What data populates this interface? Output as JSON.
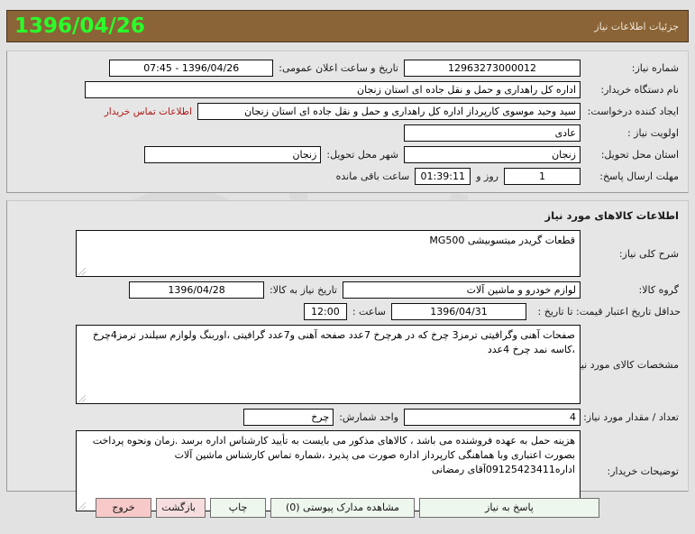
{
  "header": {
    "date": "1396/04/26",
    "title": "جزئیات اطلاعات نیاز"
  },
  "top_panel": {
    "need_number_label": "شماره نیاز:",
    "need_number_value": "12963273000012",
    "announce_label": "تاریخ و ساعت اعلان عمومی:",
    "announce_value": "1396/04/26 - 07:45",
    "buyer_org_label": "نام دستگاه خریدار:",
    "buyer_org_value": "اداره کل راهداری و حمل و نقل جاده ای استان زنجان",
    "creator_label": "ایجاد کننده درخواست:",
    "creator_value": "سید وحید موسوی کارپرداز اداره کل راهداری و حمل و نقل جاده ای استان زنجان",
    "contact_link": "اطلاعات تماس خریدار",
    "priority_label": "اولویت نیاز :",
    "priority_value": "عادی",
    "province_label": "استان محل تحویل:",
    "province_value": "زنجان",
    "city_label": "شهر محل تحویل:",
    "city_value": "زنجان",
    "deadline_label": "مهلت ارسال پاسخ:",
    "deadline_days": "1",
    "deadline_days_suffix": "روز و",
    "deadline_clock": "01:39:11",
    "deadline_suffix": "ساعت باقی مانده"
  },
  "goods_panel": {
    "title": "اطلاعات کالاهای مورد نیاز",
    "desc_label": "شرح کلی نیاز:",
    "desc_value": "قطعات گریدر میتسوبیشی MG500",
    "group_label": "گروه کالا:",
    "group_value": "لوازم خودرو و ماشین آلات",
    "need_date_label": "تاریخ نیاز به کالا:",
    "need_date_value": "1396/04/28",
    "valid_label": "حداقل تاریخ اعتبار قیمت:  تا تاریخ :",
    "valid_date_value": "1396/04/31",
    "time_label": "ساعت :",
    "time_value": "12:00",
    "specs_label": "مشخصات کالای مورد نیاز:",
    "specs_value": "صفحات آهنی وگرافیتی ترمز3 چرخ که در هرچرخ 7عدد صفحه آهنی و7عدد گرافیتی ،اوربنگ ولوازم سیلندر ترمز4چرخ ،کاسه نمد چرخ 4عدد",
    "qty_label": "تعداد / مقدار مورد نیاز:",
    "qty_value": "4",
    "unit_label": "واحد شمارش:",
    "unit_value": "چرخ",
    "notes_label": "توضیحات خریدار:",
    "notes_value": "هزینه حمل به عهده فروشنده می باشد ، کالاهای مذکور می بایست به تأیید کارشناس اداره برسد .زمان ونحوه پرداخت بصورت اعتباری وبا هماهنگی کارپرداز اداره صورت می پذیرد ،شماره تماس کارشناس ماشین آلات اداره09125423411آقای رمضانی"
  },
  "footer": {
    "answer": "پاسخ به نیاز",
    "attachments": "مشاهده مدارک پیوستی (0)",
    "print": "چاپ",
    "back": "بازگشت",
    "exit": "خروج"
  },
  "colors": {
    "header_bg": "#8a6436",
    "header_date": "#2aff2a",
    "link": "#b31515",
    "exit_btn": "#f7c9c9",
    "back_btn": "#f7dede",
    "button_bg": "#eef7ee"
  }
}
